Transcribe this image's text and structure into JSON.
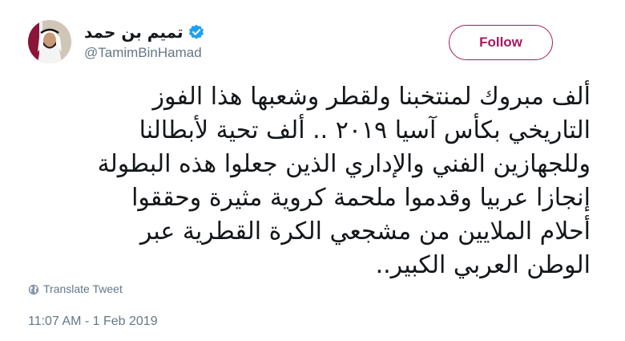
{
  "tweet": {
    "author": {
      "display_name": "تميم بن حمد",
      "handle": "@TamimBinHamad",
      "verified": true,
      "avatar_icon": "profile-photo"
    },
    "follow_label": "Follow",
    "text_lines": [
      "ألف مبروك لمنتخبنا ولقطر وشعبها هذا الفوز",
      "التاريخي بكأس آسيا ٢٠١٩ .. ألف تحية لأبطالنا",
      "وللجهازين الفني والإداري الذين جعلوا هذه البطولة",
      "إنجازا عربيا وقدموا ملحمة كروية مثيرة وحققوا",
      "أحلام الملايين من مشجعي الكرة القطرية عبر",
      "الوطن العربي الكبير.."
    ],
    "translate_label": "Translate Tweet",
    "timestamp": "11:07 AM - 1 Feb 2019"
  },
  "colors": {
    "accent": "#a8195d",
    "verified_blue": "#1da1f2",
    "secondary_text": "#657786",
    "primary_text": "#14171a"
  }
}
